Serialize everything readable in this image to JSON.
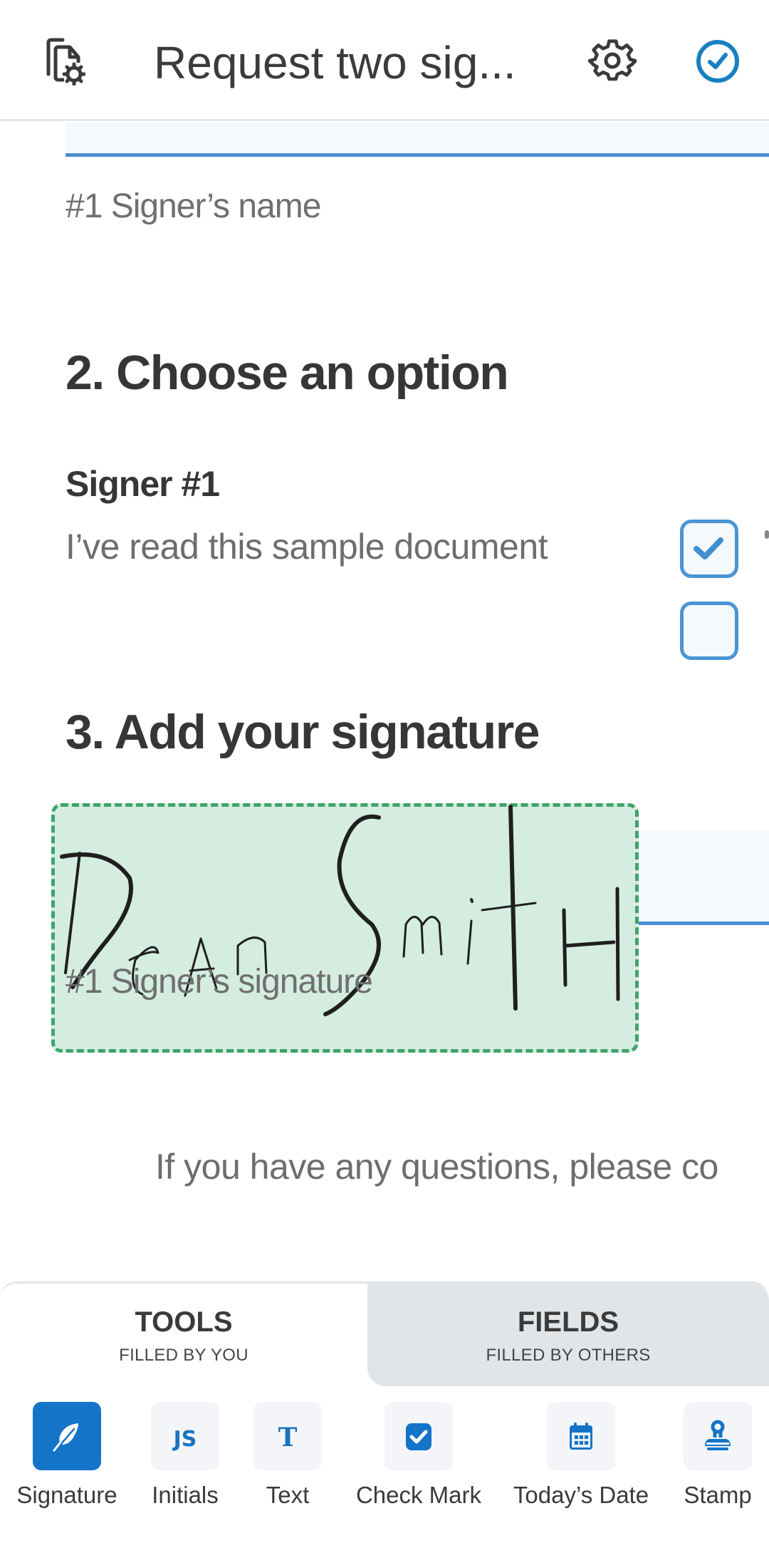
{
  "header": {
    "title": "Request two sig...",
    "left_icon": "document-settings-icon",
    "settings_icon": "gear-icon",
    "done_icon": "check-circle-icon",
    "accent_color": "#1a7fc1"
  },
  "document": {
    "name_field_caption": "#1 Signer’s name",
    "section2_heading": "2. Choose an option",
    "signer_label": "Signer #1",
    "option_text": "I’ve read this sample document",
    "checkboxes": [
      {
        "checked": true
      },
      {
        "checked": false
      }
    ],
    "section3_heading": "3. Add your signature",
    "signature_value": "Dean Smith",
    "signature_caption": "#1 Signer’s signature",
    "footer_text": "If you have any questions, please co"
  },
  "panel": {
    "tabs": [
      {
        "label": "TOOLS",
        "sublabel": "FILLED BY YOU",
        "active": true
      },
      {
        "label": "FIELDS",
        "sublabel": "FILLED BY OTHERS",
        "active": false
      }
    ],
    "tools": [
      {
        "label": "Signature",
        "icon": "feather-pen-icon",
        "active": true
      },
      {
        "label": "Initials",
        "icon": "initials-js-icon",
        "glyph": "JS",
        "active": false
      },
      {
        "label": "Text",
        "icon": "text-t-icon",
        "glyph": "T",
        "active": false
      },
      {
        "label": "Check Mark",
        "icon": "checkbox-icon",
        "active": false
      },
      {
        "label": "Today’s Date",
        "icon": "calendar-icon",
        "active": false
      },
      {
        "label": "Stamp",
        "icon": "stamp-icon",
        "active": false
      }
    ],
    "colors": {
      "tool_blue": "#1474c8",
      "signature_fill": "#d5ede1",
      "signature_border": "#3fa36a",
      "field_underline": "#4a90d0"
    }
  }
}
